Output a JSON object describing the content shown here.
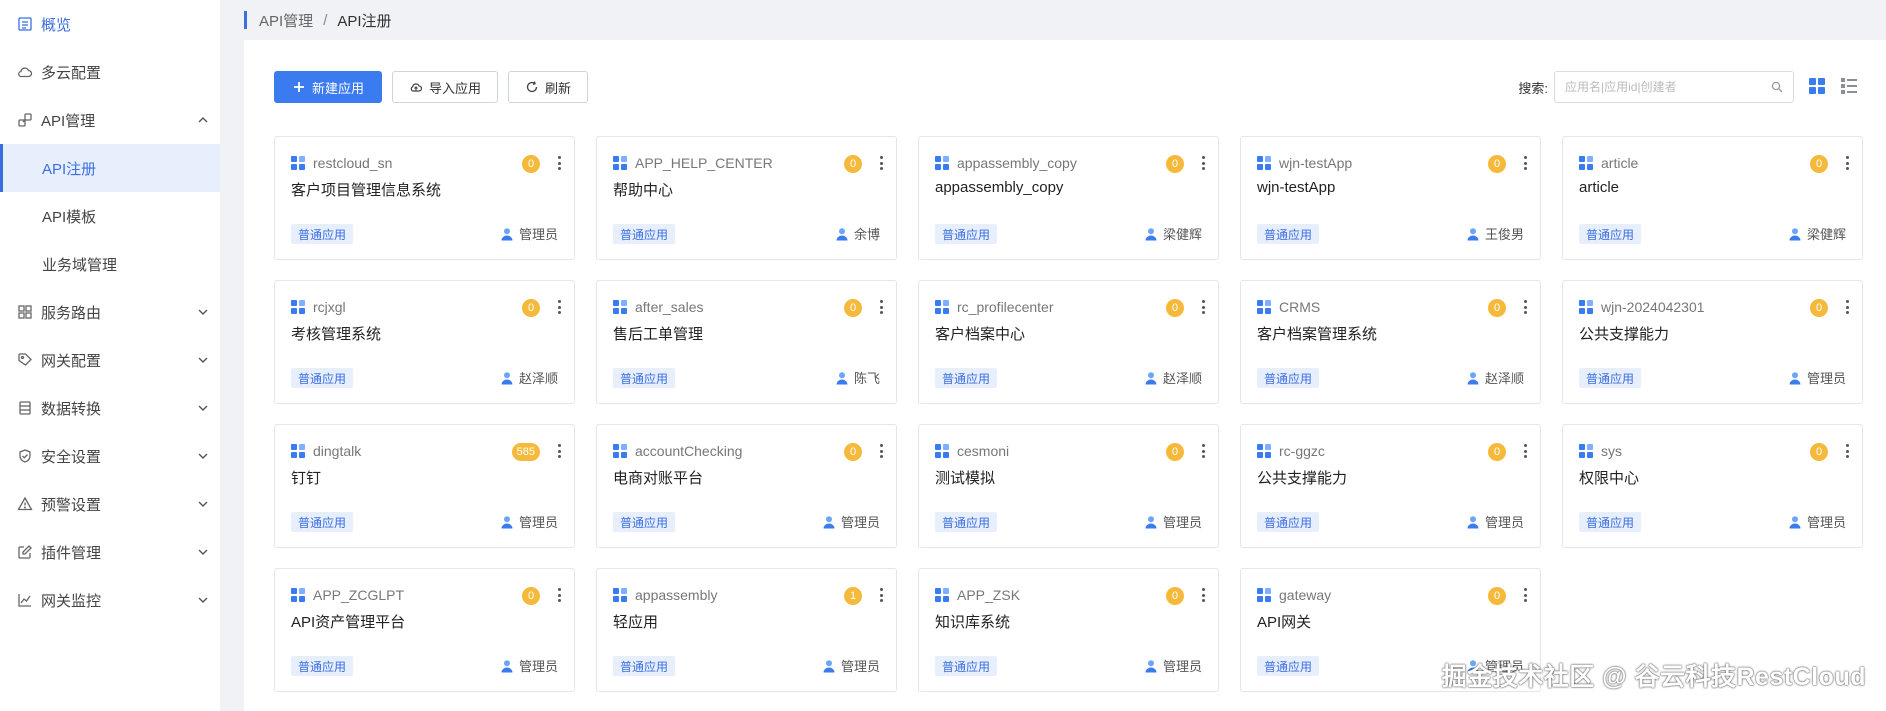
{
  "colors": {
    "accent": "#3b7bf0",
    "badge": "#f5b93b",
    "tag_bg": "#e8effc"
  },
  "sidebar": {
    "items": [
      {
        "label": "概览",
        "icon": "overview-icon"
      },
      {
        "label": "多云配置",
        "icon": "cloud-icon"
      },
      {
        "label": "API管理",
        "icon": "api-icon",
        "expanded": true,
        "children": [
          {
            "label": "API注册",
            "active": true
          },
          {
            "label": "API模板"
          },
          {
            "label": "业务域管理"
          }
        ]
      },
      {
        "label": "服务路由",
        "icon": "grid-icon"
      },
      {
        "label": "网关配置",
        "icon": "tag-icon"
      },
      {
        "label": "数据转换",
        "icon": "document-icon"
      },
      {
        "label": "安全设置",
        "icon": "shield-icon"
      },
      {
        "label": "预警设置",
        "icon": "warning-icon"
      },
      {
        "label": "插件管理",
        "icon": "edit-icon"
      },
      {
        "label": "网关监控",
        "icon": "chart-line-icon"
      }
    ]
  },
  "breadcrumb": {
    "parent": "API管理",
    "separator": "/",
    "current": "API注册"
  },
  "toolbar": {
    "new_label": "新建应用",
    "import_label": "导入应用",
    "refresh_label": "刷新"
  },
  "search": {
    "label": "搜索:",
    "placeholder": "应用名|应用id|创建者"
  },
  "apps": [
    {
      "id": "restcloud_sn",
      "name": "客户项目管理信息系统",
      "count": "0",
      "tag": "普通应用",
      "owner": "管理员"
    },
    {
      "id": "APP_HELP_CENTER",
      "name": "帮助中心",
      "count": "0",
      "tag": "普通应用",
      "owner": "余博"
    },
    {
      "id": "appassembly_copy",
      "name": "appassembly_copy",
      "count": "0",
      "tag": "普通应用",
      "owner": "梁健辉"
    },
    {
      "id": "wjn-testApp",
      "name": "wjn-testApp",
      "count": "0",
      "tag": "普通应用",
      "owner": "王俊男"
    },
    {
      "id": "article",
      "name": "article",
      "count": "0",
      "tag": "普通应用",
      "owner": "梁健辉"
    },
    {
      "id": "rcjxgl",
      "name": "考核管理系统",
      "count": "0",
      "tag": "普通应用",
      "owner": "赵泽顺"
    },
    {
      "id": "after_sales",
      "name": "售后工单管理",
      "count": "0",
      "tag": "普通应用",
      "owner": "陈飞"
    },
    {
      "id": "rc_profilecenter",
      "name": "客户档案中心",
      "count": "0",
      "tag": "普通应用",
      "owner": "赵泽顺"
    },
    {
      "id": "CRMS",
      "name": "客户档案管理系统",
      "count": "0",
      "tag": "普通应用",
      "owner": "赵泽顺"
    },
    {
      "id": "wjn-2024042301",
      "name": "公共支撑能力",
      "count": "0",
      "tag": "普通应用",
      "owner": "管理员"
    },
    {
      "id": "dingtalk",
      "name": "钉钉",
      "count": "585",
      "tag": "普通应用",
      "owner": "管理员"
    },
    {
      "id": "accountChecking",
      "name": "电商对账平台",
      "count": "0",
      "tag": "普通应用",
      "owner": "管理员"
    },
    {
      "id": "cesmoni",
      "name": "测试模拟",
      "count": "0",
      "tag": "普通应用",
      "owner": "管理员"
    },
    {
      "id": "rc-ggzc",
      "name": "公共支撑能力",
      "count": "0",
      "tag": "普通应用",
      "owner": "管理员"
    },
    {
      "id": "sys",
      "name": "权限中心",
      "count": "0",
      "tag": "普通应用",
      "owner": "管理员"
    },
    {
      "id": "APP_ZCGLPT",
      "name": "API资产管理平台",
      "count": "0",
      "tag": "普通应用",
      "owner": "管理员"
    },
    {
      "id": "appassembly",
      "name": "轻应用",
      "count": "1",
      "tag": "普通应用",
      "owner": "管理员"
    },
    {
      "id": "APP_ZSK",
      "name": "知识库系统",
      "count": "0",
      "tag": "普通应用",
      "owner": "管理员"
    },
    {
      "id": "gateway",
      "name": "API网关",
      "count": "0",
      "tag": "普通应用",
      "owner": "管理员"
    }
  ],
  "watermark": "掘金技术社区 @ 谷云科技RestCloud"
}
